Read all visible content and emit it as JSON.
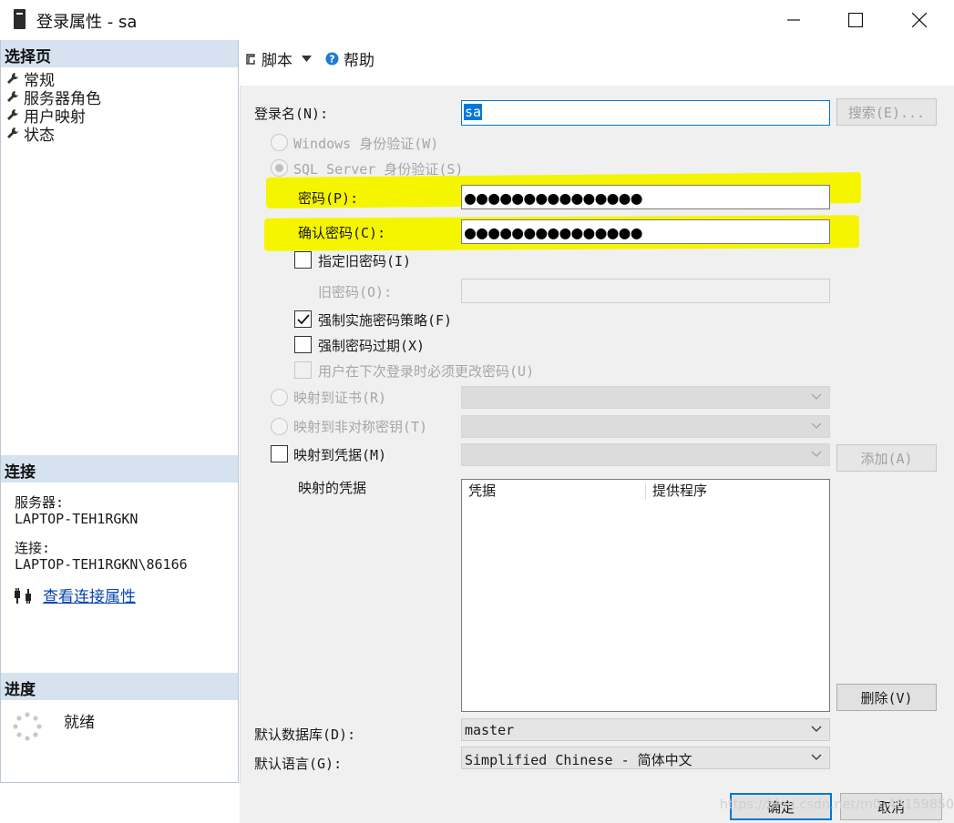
{
  "window": {
    "title": "登录属性 - sa",
    "controls": {
      "minimize": "minimize-icon",
      "maximize": "maximize-icon",
      "close": "close-icon"
    }
  },
  "left": {
    "select_page_header": "选择页",
    "pages": [
      {
        "label": "常规",
        "icon": "wrench-icon"
      },
      {
        "label": "服务器角色",
        "icon": "wrench-icon"
      },
      {
        "label": "用户映射",
        "icon": "wrench-icon"
      },
      {
        "label": "状态",
        "icon": "wrench-icon"
      }
    ],
    "connection_header": "连接",
    "server_label": "服务器:",
    "server_value": "LAPTOP-TEH1RGKN",
    "connection_label": "连接:",
    "connection_value": "LAPTOP-TEH1RGKN\\86166",
    "view_connection_link": "查看连接属性",
    "progress_header": "进度",
    "progress_status": "就绪"
  },
  "toolbar": {
    "script_label": "脚本",
    "help_label": "帮助"
  },
  "form": {
    "login_name_label": "登录名(N):",
    "login_name_value": "sa",
    "search_button": "搜索(E)...",
    "windows_auth_label": "Windows 身份验证(W)",
    "sql_auth_label": "SQL Server 身份验证(S)",
    "password_label": "密码(P):",
    "password_value": "●●●●●●●●●●●●●●●",
    "confirm_password_label": "确认密码(C):",
    "confirm_password_value": "●●●●●●●●●●●●●●●",
    "specify_old_password_label": "指定旧密码(I)",
    "old_password_label": "旧密码(O):",
    "enforce_policy_label": "强制实施密码策略(F)",
    "enforce_policy_checked": true,
    "enforce_expiration_label": "强制密码过期(X)",
    "must_change_label": "用户在下次登录时必须更改密码(U)",
    "map_certificate_label": "映射到证书(R)",
    "map_asym_key_label": "映射到非对称密钥(T)",
    "map_credential_label": "映射到凭据(M)",
    "add_button": "添加(A)",
    "mapped_credentials_label": "映射的凭据",
    "grid_columns": [
      "凭据",
      "提供程序"
    ],
    "remove_button": "删除(V)",
    "default_database_label": "默认数据库(D):",
    "default_database_value": "master",
    "default_language_label": "默认语言(G):",
    "default_language_value": "Simplified Chinese - 简体中文"
  },
  "footer": {
    "ok_button": "确定",
    "cancel_button": "取消",
    "watermark": "https://blog.csdn.net/m0_46159850"
  },
  "colors": {
    "section_header_bg": "#d6e2ef",
    "highlight": "#f5f500",
    "selection": "#0078d7",
    "link": "#0645ad"
  }
}
